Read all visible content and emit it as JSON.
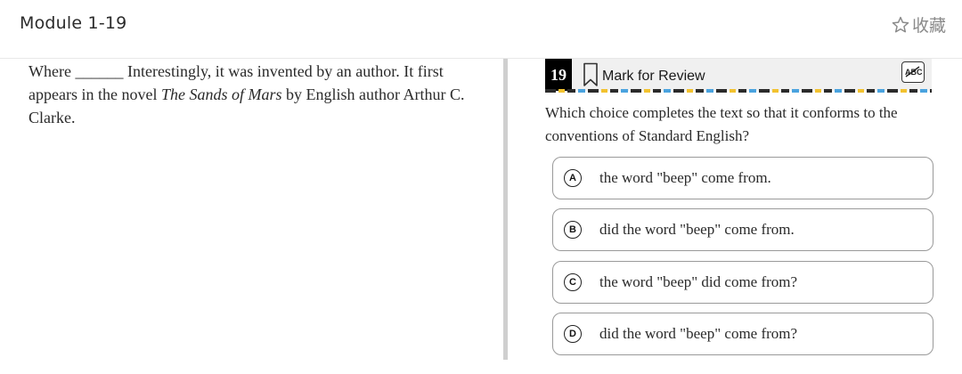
{
  "header": {
    "title": "Module 1-19",
    "favorite_label": "收藏",
    "favorite_icon": "star-outline-icon"
  },
  "passage": {
    "prefix": "Where",
    "blank": "______",
    "text_1": " Interestingly, it was invented by an author. It first appears in  the novel ",
    "book_title": "The Sands of Mars",
    "text_2": " by English author Arthur C. Clarke."
  },
  "question": {
    "number": "19",
    "mark_label": "Mark for Review",
    "bookmark_icon": "bookmark-icon",
    "strike_tool_icon": "abc-strikethrough-icon",
    "prompt": "Which choice completes the text so that it conforms to the conventions of Standard English?",
    "choices": [
      {
        "letter": "A",
        "text": "the word \"beep\" come from."
      },
      {
        "letter": "B",
        "text": "did the word \"beep\" come from."
      },
      {
        "letter": "C",
        "text": "the word \"beep\" did come from?"
      },
      {
        "letter": "D",
        "text": "did the word \"beep\" come from?"
      }
    ]
  }
}
